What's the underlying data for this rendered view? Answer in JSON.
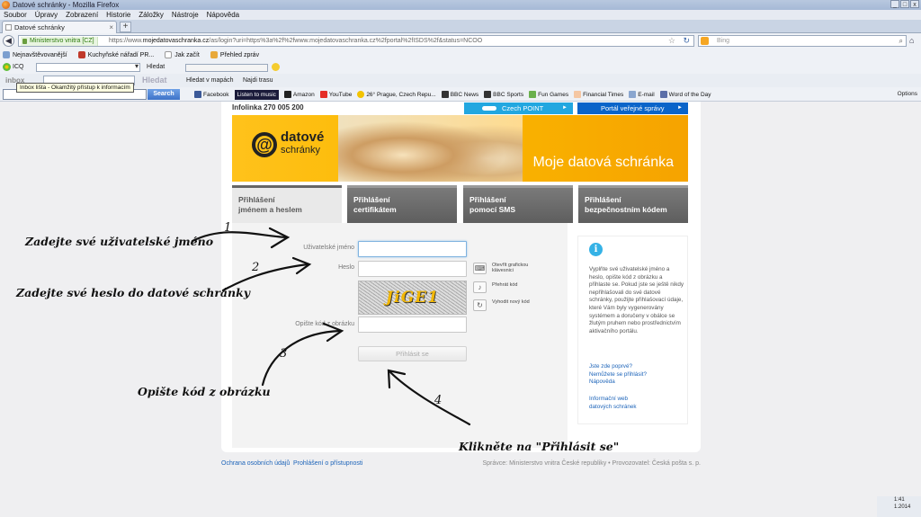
{
  "window": {
    "title": "Datové schránky - Mozilla Firefox"
  },
  "menu": [
    "Soubor",
    "Úpravy",
    "Zobrazení",
    "Historie",
    "Záložky",
    "Nástroje",
    "Nápověda"
  ],
  "tab": {
    "label": "Datové schránky",
    "close": "×",
    "new": "+"
  },
  "nav": {
    "site_badge": "Ministerstvo vnitra [CZ]",
    "url_prefix": "https://www.",
    "url_domain": "mojedatovaschranka.cz",
    "url_rest": "/as/login?uri=https%3a%2f%2fwww.mojedatovaschranka.cz%2fportal%2fISDS%2f&status=NCOO",
    "search_placeholder": "Bing"
  },
  "bookmarks": [
    "Nejnavštěvovanější",
    "Kuchyňské nářadí PR...",
    "Jak začít",
    "Přehled zpráv"
  ],
  "icq": {
    "label": "ICQ",
    "find": "Hledat"
  },
  "inbox": {
    "logo": "inbox",
    "hledat": "Hledat",
    "maps": "Hledat v mapách",
    "route": "Najdi trasu",
    "tooltip": "Inbox lišta - Okamžitý přístup k informacím"
  },
  "toolbar": {
    "search_button": "Search",
    "items": [
      "Facebook",
      "Listen to music",
      "Amazon",
      "YouTube",
      "26° Prague, Czech Repu...",
      "BBC News",
      "BBC Sports",
      "Fun Games",
      "Financial Times",
      "E-mail",
      "Word of the Day"
    ],
    "options": "Options"
  },
  "page": {
    "infolinka": "Infolinka 270 005 200",
    "czpoint": "Czech POINT",
    "portal": "Portál veřejné správy",
    "logo_main": "datové",
    "logo_sub": "schránky",
    "slogan": "Moje datová schránka",
    "tabs": [
      {
        "l1": "Přihlášení",
        "l2": "jménem a heslem"
      },
      {
        "l1": "Přihlášení",
        "l2": "certifikátem"
      },
      {
        "l1": "Přihlášení",
        "l2": "pomocí SMS"
      },
      {
        "l1": "Přihlášení",
        "l2": "bezpečnostním kódem"
      }
    ],
    "form": {
      "username_label": "Uživatelské jméno",
      "password_label": "Heslo",
      "captcha_label": "Opište kód z obrázku",
      "captcha_code": "JiGE1",
      "keyboard_text": "Otevřít grafickou klávesnici",
      "audio_text": "Přehrát kód",
      "refresh_text": "Vyhodit nový kód",
      "submit": "Přihlásit se"
    },
    "info": {
      "text": "Vyplňte své uživatelské jméno a heslo, opište kód z obrázku a přihlaste se. Pokud jste se ještě nikdy nepřihlašovali do své datové schránky, použijte přihlašovací údaje, které Vám byly vygenerovány systémem a doručeny v obálce se žlutým pruhem nebo prostřednictvím aktivačního portálu.",
      "link1": "Jste zde poprvé?",
      "link2": "Nemůžete se přihlásit?",
      "link3": "Nápověda",
      "link4a": "Informační web",
      "link4b": "datových schránek"
    },
    "footer": {
      "privacy": "Ochrana osobních údajů",
      "access": "Prohlášení o přístupnosti",
      "admin": "Správce: Ministerstvo vnitra České republiky • Provozovatel: Česká pošta s. p."
    }
  },
  "annotations": {
    "n1": "1",
    "n2": "2",
    "n3": "3",
    "n4": "4",
    "a1": "Zadejte své uživatelské jméno",
    "a2": "Zadejte své heslo do datové schránky",
    "a3": "Opište kód z obrázku",
    "a4": "Klikněte na \"Přihlásit se\""
  },
  "taskbar": {
    "time": "1:41",
    "date": "1.2014"
  },
  "colors": {
    "czpoint": "#22a7e0",
    "portal": "#0a64c9",
    "banner": "#ffc21b",
    "link": "#1d64b9"
  }
}
